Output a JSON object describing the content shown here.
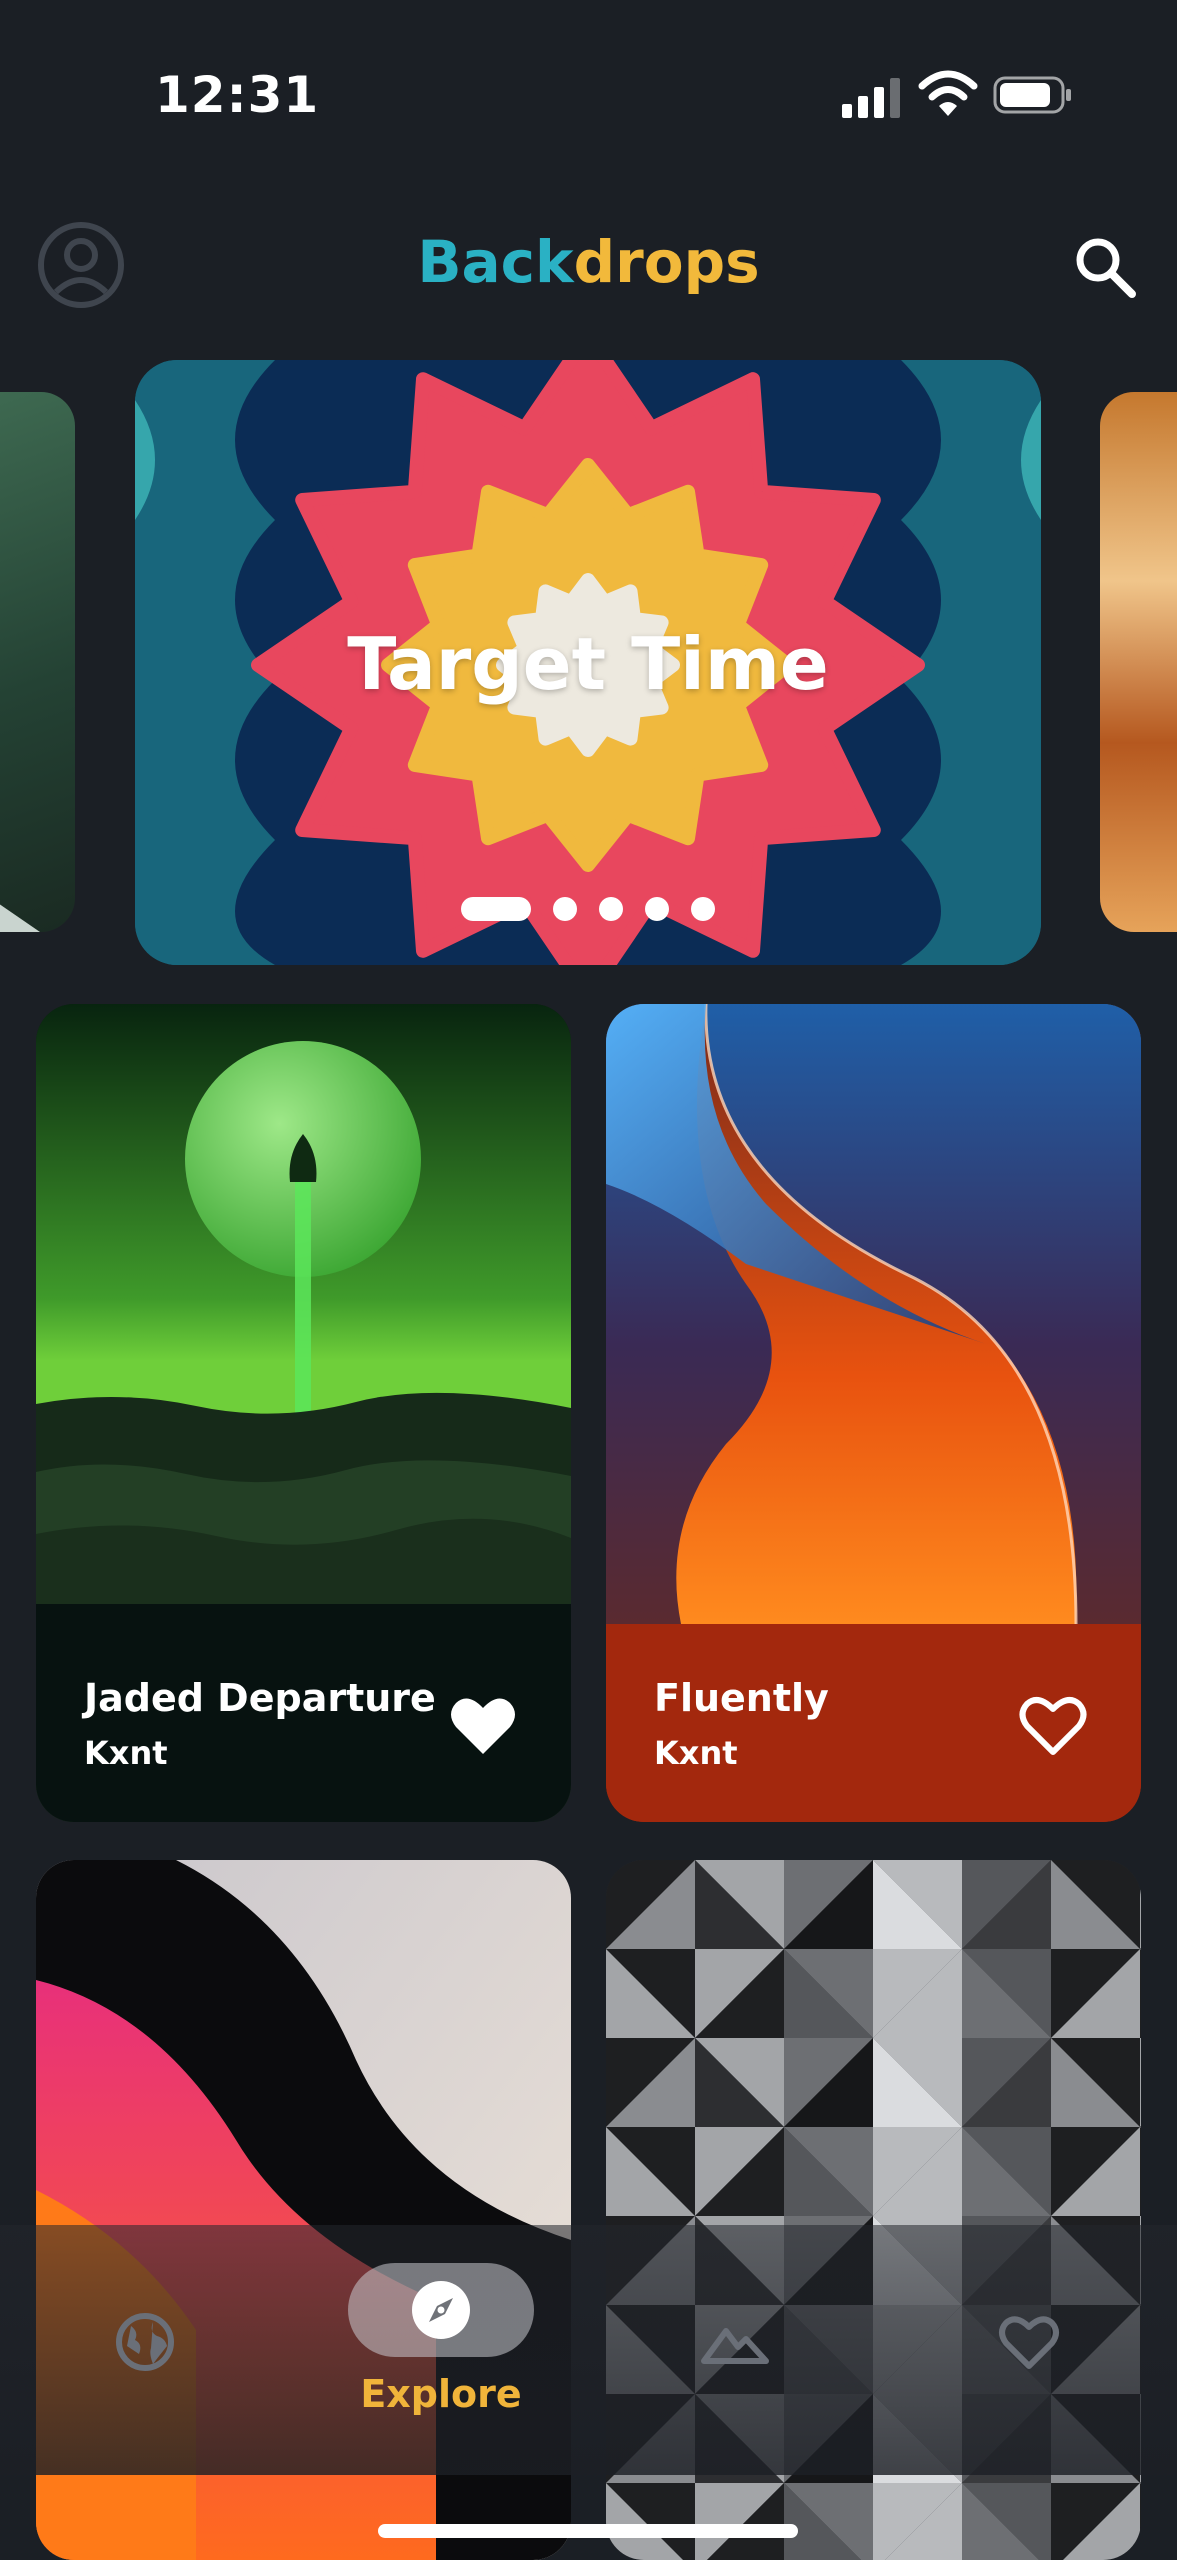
{
  "status_bar": {
    "time": "12:31"
  },
  "header": {
    "title_part1": "Back",
    "title_part2": "drops",
    "title_color1": "#2ab1c4",
    "title_color2": "#f2b93b"
  },
  "featured": {
    "title": "Target Time",
    "page_count": 5,
    "active_page": 0
  },
  "cards": [
    {
      "title": "Jaded Departure",
      "author": "Kxnt",
      "favorited": true
    },
    {
      "title": "Fluently",
      "author": "Kxnt",
      "favorited": false
    }
  ],
  "tab_bar": {
    "active_label": "Explore",
    "accent_color": "#f0b43a",
    "icons": [
      "globe-icon",
      "compass-icon",
      "mountain-icon",
      "heart-icon"
    ]
  }
}
